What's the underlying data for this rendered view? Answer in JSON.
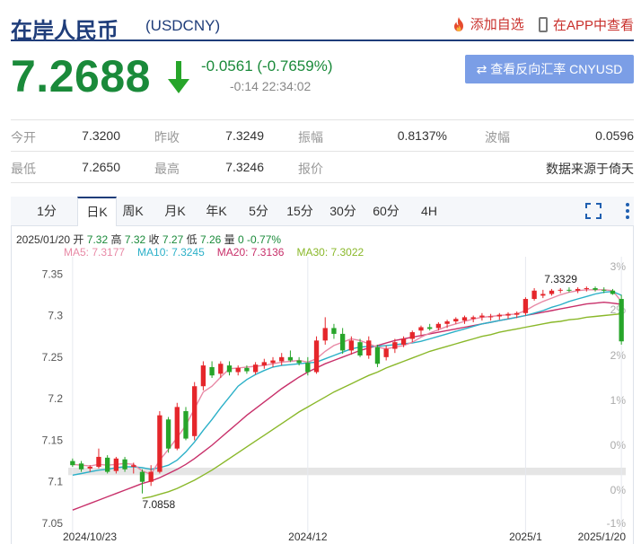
{
  "header": {
    "title": "在岸人民币",
    "code": "(USDCNY)",
    "add_watch": "添加自选",
    "app_view": "在APP中查看"
  },
  "quote": {
    "price": "7.2688",
    "change": "-0.0561 (-0.7659%)",
    "time": "-0:14 22:34:02",
    "reverse_button": "查看反向汇率 CNYUSD"
  },
  "stats": {
    "row1": [
      {
        "label": "今开",
        "value": "7.3200"
      },
      {
        "label": "昨收",
        "value": "7.3249"
      },
      {
        "label": "振幅",
        "value": "0.8137%"
      },
      {
        "label": "波幅",
        "value": "0.0596"
      }
    ],
    "row2": [
      {
        "label": "最低",
        "value": "7.2650"
      },
      {
        "label": "最高",
        "value": "7.3246"
      },
      {
        "label": "报价",
        "value": "数据来源于倚天"
      }
    ]
  },
  "tabs": [
    "1分",
    "日K",
    "周K",
    "月K",
    "年K",
    "5分",
    "15分",
    "30分",
    "60分",
    "4H"
  ],
  "active_tab": 1,
  "ohlc_info": {
    "date": "2025/01/20",
    "open_label": "开",
    "open": "7.32",
    "high_label": "高",
    "high": "7.32",
    "close_label": "收",
    "close": "7.27",
    "low_label": "低",
    "low": "7.26",
    "vol_label": "量",
    "vol": "0",
    "pct": "-0.77%"
  },
  "ma_legend": [
    {
      "label": "MA5: 7.3177",
      "color": "#e88aa6"
    },
    {
      "label": "MA10: 7.3245",
      "color": "#2bb0c8"
    },
    {
      "label": "MA20: 7.3136",
      "color": "#c8306a"
    },
    {
      "label": "MA30: 7.3022",
      "color": "#8ab82a"
    }
  ],
  "colors": {
    "up": "#e5262b",
    "down": "#27a52a",
    "brand": "#1f3d7a",
    "price_green": "#1a8a3a"
  },
  "chart_data": {
    "type": "candlestick",
    "ylim": [
      7.05,
      7.36
    ],
    "yticks": [
      "7.35",
      "7.3",
      "7.25",
      "7.2",
      "7.15",
      "7.1",
      "7.05"
    ],
    "pct_ticks": [
      "3%",
      "2%",
      "2%",
      "1%",
      "0%",
      "0%",
      "-1%"
    ],
    "xticks": [
      {
        "label": "2024/10/23",
        "index": 0
      },
      {
        "label": "2024/12",
        "index": 27
      },
      {
        "label": "2025/1",
        "index": 52
      },
      {
        "label": "2025/1/20",
        "index": 63
      }
    ],
    "annotations": [
      {
        "text": "7.3329",
        "index": 56,
        "value": 7.3329
      },
      {
        "text": "7.0858",
        "index": 8,
        "value": 7.0858
      }
    ],
    "series_ohlc": [
      [
        7.125,
        7.128,
        7.118,
        7.12
      ],
      [
        7.122,
        7.125,
        7.112,
        7.115
      ],
      [
        7.116,
        7.12,
        7.112,
        7.118
      ],
      [
        7.118,
        7.14,
        7.116,
        7.13
      ],
      [
        7.129,
        7.132,
        7.11,
        7.112
      ],
      [
        7.113,
        7.13,
        7.11,
        7.128
      ],
      [
        7.127,
        7.13,
        7.112,
        7.115
      ],
      [
        7.118,
        7.123,
        7.11,
        7.12
      ],
      [
        7.112,
        7.115,
        7.086,
        7.1
      ],
      [
        7.1,
        7.12,
        7.095,
        7.112
      ],
      [
        7.112,
        7.185,
        7.11,
        7.18
      ],
      [
        7.175,
        7.178,
        7.135,
        7.14
      ],
      [
        7.14,
        7.195,
        7.138,
        7.19
      ],
      [
        7.185,
        7.19,
        7.15,
        7.152
      ],
      [
        7.155,
        7.22,
        7.15,
        7.215
      ],
      [
        7.215,
        7.245,
        7.21,
        7.24
      ],
      [
        7.238,
        7.245,
        7.225,
        7.228
      ],
      [
        7.23,
        7.245,
        7.225,
        7.242
      ],
      [
        7.24,
        7.245,
        7.228,
        7.232
      ],
      [
        7.232,
        7.24,
        7.228,
        7.237
      ],
      [
        7.237,
        7.24,
        7.23,
        7.233
      ],
      [
        7.232,
        7.244,
        7.229,
        7.241
      ],
      [
        7.24,
        7.248,
        7.236,
        7.244
      ],
      [
        7.243,
        7.25,
        7.238,
        7.246
      ],
      [
        7.245,
        7.255,
        7.24,
        7.25
      ],
      [
        7.25,
        7.258,
        7.244,
        7.246
      ],
      [
        7.246,
        7.25,
        7.24,
        7.243
      ],
      [
        7.243,
        7.25,
        7.228,
        7.232
      ],
      [
        7.232,
        7.275,
        7.23,
        7.27
      ],
      [
        7.27,
        7.298,
        7.265,
        7.285
      ],
      [
        7.285,
        7.29,
        7.272,
        7.278
      ],
      [
        7.278,
        7.285,
        7.254,
        7.258
      ],
      [
        7.258,
        7.275,
        7.253,
        7.27
      ],
      [
        7.268,
        7.272,
        7.25,
        7.252
      ],
      [
        7.252,
        7.275,
        7.248,
        7.27
      ],
      [
        7.262,
        7.265,
        7.238,
        7.242
      ],
      [
        7.25,
        7.264,
        7.246,
        7.26
      ],
      [
        7.26,
        7.272,
        7.255,
        7.268
      ],
      [
        7.265,
        7.275,
        7.262,
        7.272
      ],
      [
        7.272,
        7.282,
        7.268,
        7.28
      ],
      [
        7.282,
        7.288,
        7.276,
        7.286
      ],
      [
        7.286,
        7.29,
        7.282,
        7.284
      ],
      [
        7.285,
        7.292,
        7.282,
        7.29
      ],
      [
        7.29,
        7.295,
        7.285,
        7.293
      ],
      [
        7.293,
        7.298,
        7.29,
        7.296
      ],
      [
        7.294,
        7.3,
        7.29,
        7.298
      ],
      [
        7.296,
        7.3,
        7.292,
        7.298
      ],
      [
        7.298,
        7.303,
        7.294,
        7.3
      ],
      [
        7.298,
        7.302,
        7.294,
        7.299
      ],
      [
        7.299,
        7.303,
        7.295,
        7.301
      ],
      [
        7.3,
        7.304,
        7.296,
        7.302
      ],
      [
        7.301,
        7.305,
        7.297,
        7.303
      ],
      [
        7.303,
        7.322,
        7.3,
        7.32
      ],
      [
        7.32,
        7.333,
        7.318,
        7.33
      ],
      [
        7.324,
        7.331,
        7.321,
        7.326
      ],
      [
        7.326,
        7.332,
        7.324,
        7.33
      ],
      [
        7.33,
        7.333,
        7.327,
        7.331
      ],
      [
        7.331,
        7.334,
        7.328,
        7.33
      ],
      [
        7.33,
        7.334,
        7.327,
        7.332
      ],
      [
        7.332,
        7.335,
        7.329,
        7.333
      ],
      [
        7.333,
        7.335,
        7.329,
        7.331
      ],
      [
        7.331,
        7.334,
        7.327,
        7.33
      ],
      [
        7.33,
        7.332,
        7.325,
        7.326
      ],
      [
        7.32,
        7.325,
        7.265,
        7.269
      ]
    ],
    "ma5": [
      7.121,
      7.12,
      7.119,
      7.121,
      7.12,
      7.121,
      7.122,
      7.121,
      7.113,
      7.109,
      7.126,
      7.139,
      7.153,
      7.168,
      7.188,
      7.208,
      7.215,
      7.226,
      7.236,
      7.237,
      7.238,
      7.239,
      7.24,
      7.242,
      7.244,
      7.245,
      7.246,
      7.244,
      7.248,
      7.257,
      7.264,
      7.268,
      7.272,
      7.27,
      7.266,
      7.262,
      7.26,
      7.262,
      7.264,
      7.268,
      7.274,
      7.279,
      7.283,
      7.287,
      7.29,
      7.293,
      7.296,
      7.298,
      7.299,
      7.3,
      7.301,
      7.302,
      7.306,
      7.312,
      7.317,
      7.321,
      7.325,
      7.328,
      7.33,
      7.331,
      7.331,
      7.331,
      7.33,
      7.317
    ],
    "ma10": [
      7.108,
      7.11,
      7.112,
      7.114,
      7.115,
      7.117,
      7.118,
      7.118,
      7.117,
      7.115,
      7.117,
      7.12,
      7.126,
      7.136,
      7.148,
      7.162,
      7.175,
      7.189,
      7.202,
      7.215,
      7.223,
      7.229,
      7.234,
      7.238,
      7.24,
      7.241,
      7.242,
      7.243,
      7.244,
      7.248,
      7.252,
      7.256,
      7.26,
      7.262,
      7.263,
      7.263,
      7.264,
      7.265,
      7.266,
      7.267,
      7.269,
      7.272,
      7.275,
      7.278,
      7.281,
      7.284,
      7.287,
      7.29,
      7.292,
      7.294,
      7.296,
      7.298,
      7.3,
      7.303,
      7.306,
      7.31,
      7.313,
      7.317,
      7.32,
      7.323,
      7.326,
      7.328,
      7.329,
      7.3245
    ],
    "ma20": [
      7.066,
      7.07,
      7.074,
      7.078,
      7.082,
      7.086,
      7.09,
      7.094,
      7.098,
      7.101,
      7.105,
      7.11,
      7.115,
      7.121,
      7.128,
      7.136,
      7.144,
      7.153,
      7.162,
      7.171,
      7.18,
      7.188,
      7.196,
      7.204,
      7.212,
      7.219,
      7.226,
      7.232,
      7.237,
      7.242,
      7.246,
      7.25,
      7.254,
      7.258,
      7.261,
      7.264,
      7.267,
      7.27,
      7.272,
      7.274,
      7.276,
      7.278,
      7.28,
      7.282,
      7.284,
      7.286,
      7.288,
      7.29,
      7.292,
      7.294,
      7.296,
      7.298,
      7.3,
      7.302,
      7.304,
      7.306,
      7.308,
      7.31,
      7.312,
      7.314,
      7.315,
      7.316,
      7.315,
      7.3136
    ],
    "ma30": [
      null,
      null,
      null,
      null,
      null,
      null,
      null,
      null,
      7.08,
      7.082,
      7.085,
      7.088,
      7.092,
      7.097,
      7.102,
      7.108,
      7.114,
      7.121,
      7.128,
      7.135,
      7.142,
      7.149,
      7.156,
      7.163,
      7.17,
      7.177,
      7.184,
      7.19,
      7.196,
      7.202,
      7.208,
      7.213,
      7.218,
      7.223,
      7.228,
      7.232,
      7.237,
      7.241,
      7.245,
      7.249,
      7.253,
      7.257,
      7.26,
      7.263,
      7.266,
      7.269,
      7.272,
      7.275,
      7.277,
      7.28,
      7.282,
      7.284,
      7.286,
      7.288,
      7.29,
      7.292,
      7.293,
      7.295,
      7.296,
      7.298,
      7.299,
      7.3,
      7.301,
      7.3022
    ]
  }
}
